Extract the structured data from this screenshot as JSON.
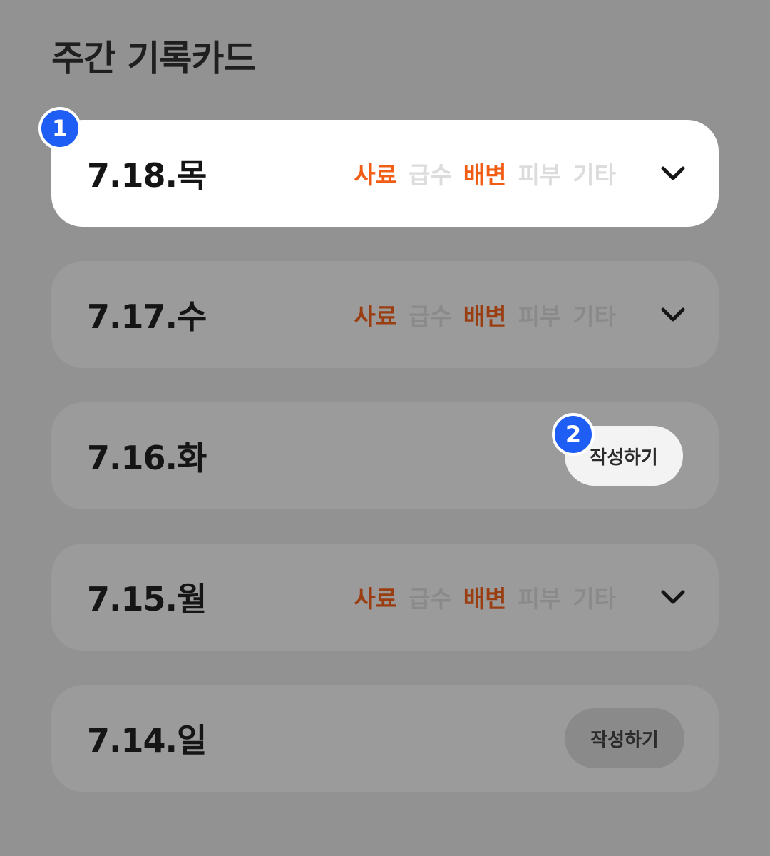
{
  "header": {
    "title": "주간 기록카드"
  },
  "colors": {
    "active_highlight": "#f25d15",
    "active_dim": "#9a3e12",
    "inactive_highlight": "#dcdcdc",
    "inactive_dim": "#8a8a8a",
    "badge": "#1e5ef5"
  },
  "categories": [
    "사료",
    "급수",
    "배변",
    "피부",
    "기타"
  ],
  "cards": [
    {
      "date": "7.18.목",
      "state": "filled",
      "highlighted": true,
      "active": [
        true,
        false,
        true,
        false,
        false
      ]
    },
    {
      "date": "7.17.수",
      "state": "filled",
      "highlighted": false,
      "active": [
        true,
        false,
        true,
        false,
        false
      ]
    },
    {
      "date": "7.16.화",
      "state": "empty",
      "highlighted": false,
      "write_label": "작성하기"
    },
    {
      "date": "7.15.월",
      "state": "filled",
      "highlighted": false,
      "active": [
        true,
        false,
        true,
        false,
        false
      ]
    },
    {
      "date": "7.14.일",
      "state": "empty",
      "highlighted": false,
      "write_label": "작성하기"
    }
  ],
  "badges": [
    {
      "number": "1",
      "icon": "step-badge-icon"
    },
    {
      "number": "2",
      "icon": "step-badge-icon"
    }
  ]
}
